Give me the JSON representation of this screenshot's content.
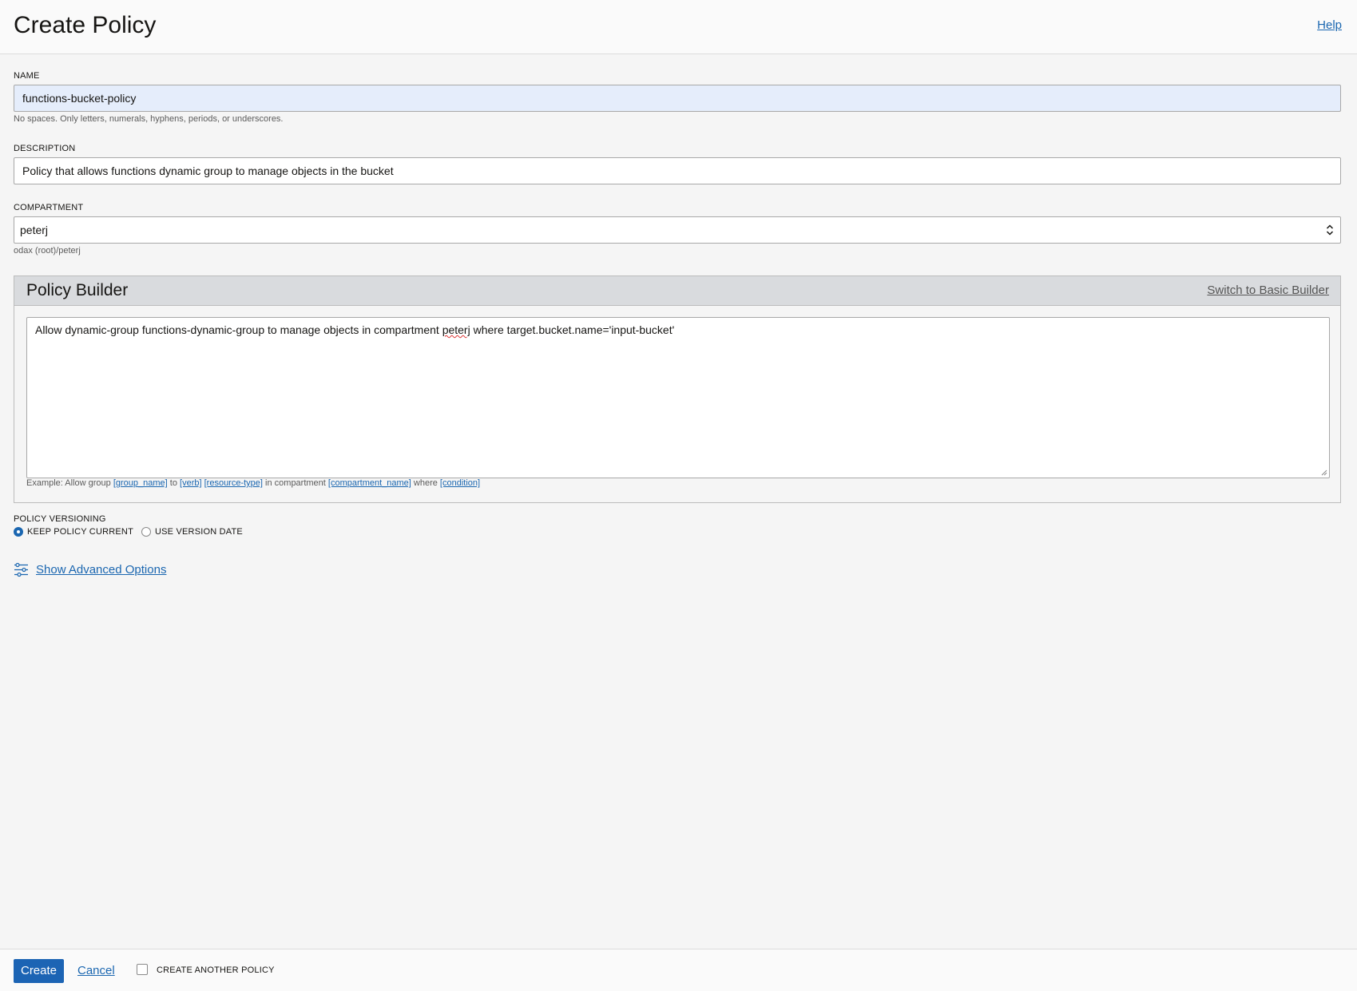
{
  "header": {
    "title": "Create Policy",
    "help_label": "Help"
  },
  "form": {
    "name": {
      "label": "NAME",
      "value": "functions-bucket-policy",
      "hint": "No spaces. Only letters, numerals, hyphens, periods, or underscores."
    },
    "description": {
      "label": "DESCRIPTION",
      "value": "Policy that allows functions dynamic group to manage objects in the bucket"
    },
    "compartment": {
      "label": "COMPARTMENT",
      "value": "peterj",
      "path": "odax (root)/peterj"
    }
  },
  "policy_builder": {
    "title": "Policy Builder",
    "switch_label": "Switch to Basic Builder",
    "statement_before": "Allow dynamic-group functions-dynamic-group to manage objects in compartment ",
    "statement_flagged": "peterj",
    "statement_after": " where target.bucket.name='input-bucket'",
    "example": {
      "prefix": "Example: Allow group ",
      "group_name": "[group_name]",
      "to": " to ",
      "verb": "[verb]",
      "resource_type": "[resource-type]",
      "in_compartment": " in compartment ",
      "compartment_name": "[compartment_name]",
      "where": " where ",
      "condition": "[condition]"
    }
  },
  "versioning": {
    "label": "POLICY VERSIONING",
    "options": [
      {
        "label": "KEEP POLICY CURRENT",
        "selected": true
      },
      {
        "label": "USE VERSION DATE",
        "selected": false
      }
    ]
  },
  "advanced": {
    "label": "Show Advanced Options",
    "icon": "sliders-icon"
  },
  "footer": {
    "create_label": "Create",
    "cancel_label": "Cancel",
    "create_another_label": "CREATE ANOTHER POLICY",
    "create_another_checked": false
  },
  "colors": {
    "accent": "#1c64b4",
    "link": "#1a66b0",
    "page_bg": "#f5f5f5",
    "builder_header_bg": "#d9dbde",
    "filled_input_bg": "#e5edfb"
  }
}
